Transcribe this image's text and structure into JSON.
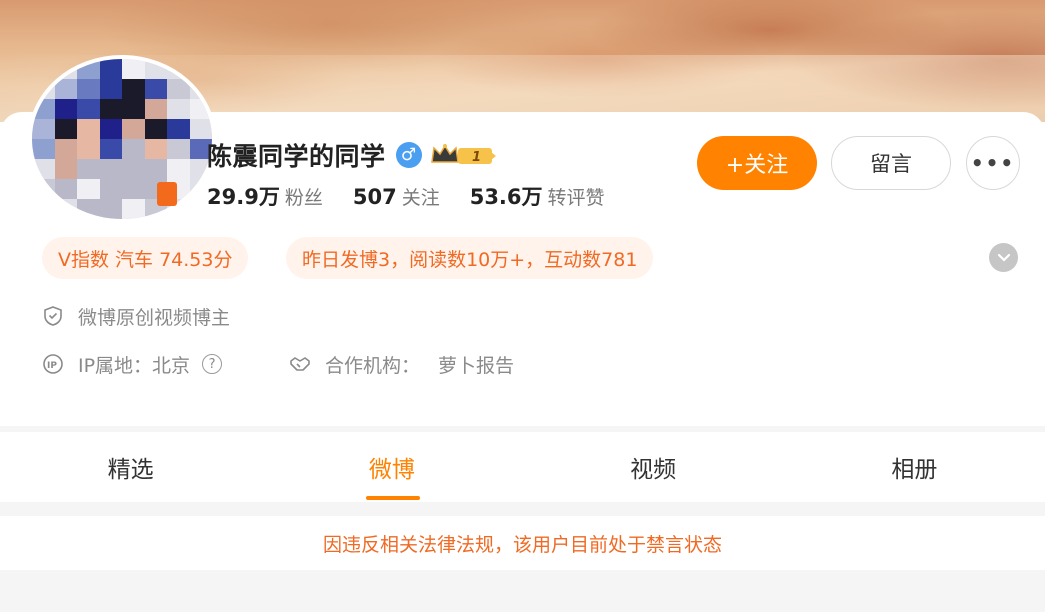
{
  "profile": {
    "name": "陈震同学的同学",
    "gender_symbol": "♂",
    "vip_level": "1",
    "stats": [
      {
        "value": "29.9万",
        "label": "粉丝"
      },
      {
        "value": "507",
        "label": "关注"
      },
      {
        "value": "53.6万",
        "label": "转评赞"
      }
    ]
  },
  "actions": {
    "follow_label": "+关注",
    "message_label": "留言",
    "more_label": "•••"
  },
  "tags": {
    "v_index": "V指数 汽车 74.53分",
    "yesterday": "昨日发博3，阅读数10万+，互动数781"
  },
  "info": {
    "original_creator": "微博原创视频博主",
    "ip_label": "IP属地：北京",
    "help_symbol": "?",
    "partner_label": "合作机构：",
    "partner_value": "萝卜报告"
  },
  "tabs": [
    {
      "label": "精选"
    },
    {
      "label": "微博"
    },
    {
      "label": "视频"
    },
    {
      "label": "相册"
    }
  ],
  "active_tab": "微博",
  "notice": "因违反相关法律法规，该用户目前处于禁言状态",
  "colors": {
    "accent": "#ff8200",
    "tag_text": "#f06a24",
    "tag_bg": "#fff3ec"
  }
}
